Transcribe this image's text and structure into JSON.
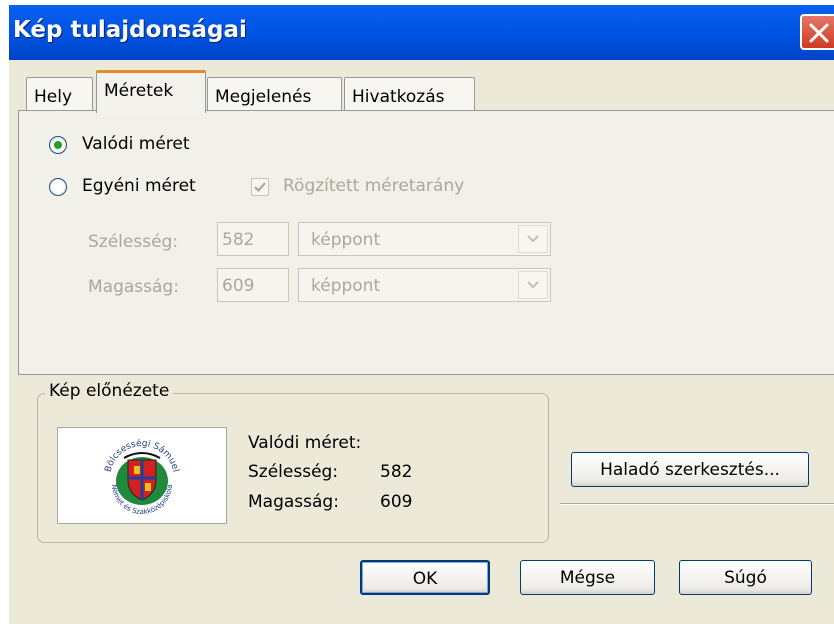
{
  "window": {
    "title": "Kép tulajdonságai"
  },
  "tabs": [
    {
      "label": "Hely"
    },
    {
      "label": "Méretek",
      "active": true
    },
    {
      "label": "Megjelenés"
    },
    {
      "label": "Hivatkozás"
    }
  ],
  "size": {
    "actual_label": "Valódi méret",
    "actual_selected": true,
    "custom_label": "Egyéni méret",
    "custom_selected": false,
    "keep_ratio_label": "Rögzített méretarány",
    "keep_ratio_checked": true,
    "width_label": "Szélesség:",
    "width_value": "582",
    "width_unit": "képpont",
    "height_label": "Magasság:",
    "height_value": "609",
    "height_unit": "képpont"
  },
  "preview": {
    "group_title": "Kép előnézete",
    "info_title": "Valódi méret:",
    "width_label": "Szélesség:",
    "width_value": "582",
    "height_label": "Magasság:",
    "height_value": "609",
    "thumbnail_icon": "coat-of-arms-emblem-icon",
    "emblem_top_text": "Bölcsességi Sámuel",
    "emblem_bottom_text": "Német és Szakközépiskola"
  },
  "buttons": {
    "advanced": "Haladó szerkesztés...",
    "ok": "OK",
    "cancel": "Mégse",
    "help": "Súgó"
  },
  "colors": {
    "titlebar": "#0054e3",
    "close": "#cf3b22",
    "radio_dot": "#21a121",
    "active_tab_accent": "#e68b2c"
  }
}
